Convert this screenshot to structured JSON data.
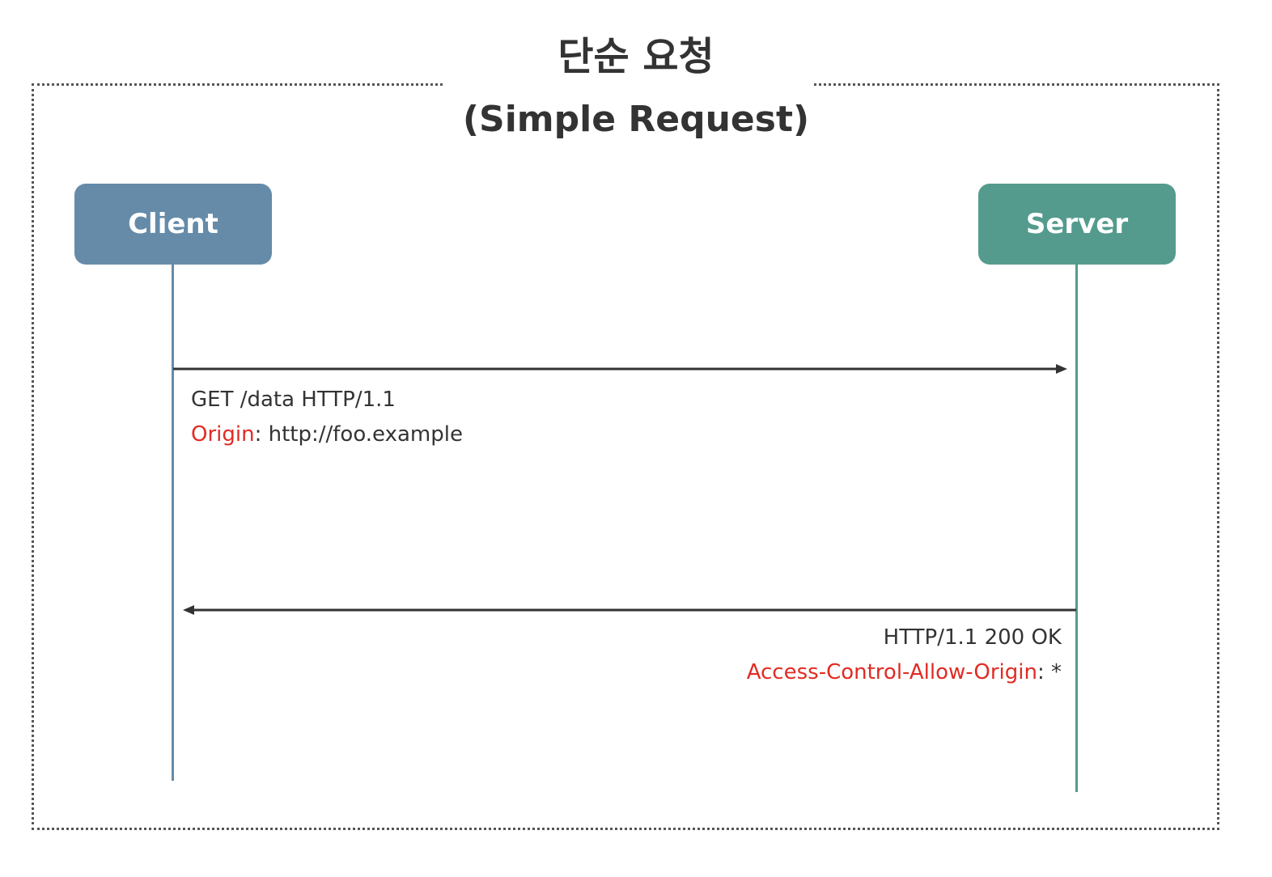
{
  "title": {
    "korean": "단순 요청",
    "english": "(Simple Request)"
  },
  "actors": {
    "client": {
      "label": "Client",
      "color": "#658ba9",
      "lifeline_color": "#658ba9"
    },
    "server": {
      "label": "Server",
      "color": "#549b8d",
      "lifeline_color": "#549b8d"
    }
  },
  "messages": {
    "request": {
      "line1": "GET  /data HTTP/1.1",
      "header_name": "Origin",
      "separator": ": ",
      "header_value": "http://foo.example"
    },
    "response": {
      "line1": "HTTP/1.1 200 OK",
      "header_name": "Access-Control-Allow-Origin",
      "separator": ": ",
      "header_value": "*"
    }
  },
  "colors": {
    "highlight": "#e12b23",
    "text": "#333333",
    "arrow": "#333333",
    "frame": "#555555"
  }
}
